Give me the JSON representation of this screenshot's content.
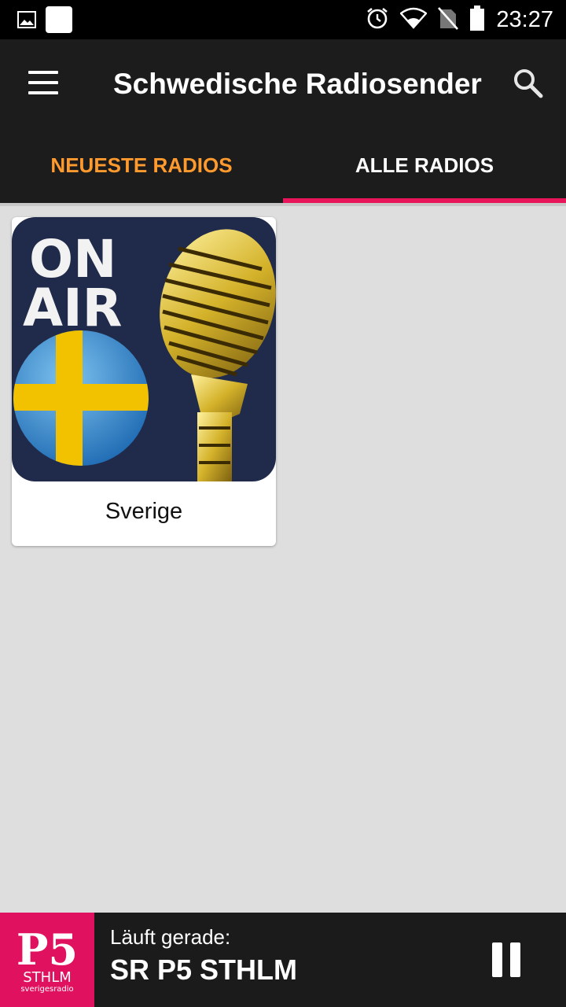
{
  "status_bar": {
    "time": "23:27",
    "icons": [
      "image-notification-icon",
      "app-notification-icon",
      "alarm-icon",
      "wifi-icon",
      "no-sim-icon",
      "battery-icon"
    ]
  },
  "app_bar": {
    "title": "Schwedische Radiosender",
    "menu_icon": "hamburger-menu-icon",
    "search_icon": "search-icon"
  },
  "tabs": [
    {
      "label": "NEUESTE RADIOS",
      "active": true
    },
    {
      "label": "ALLE RADIOS",
      "active": false
    }
  ],
  "colors": {
    "accent_orange": "#ff9a2e",
    "indicator_pink": "#e8155a",
    "player_logo": "#e0115f"
  },
  "stations": [
    {
      "name": "Sverige",
      "image_text": [
        "ON",
        "AIR"
      ]
    }
  ],
  "player": {
    "now_playing_label": "Läuft gerade:",
    "station": "SR P5 STHLM",
    "logo_lines": [
      "P5",
      "STHLM",
      "sverigesradio"
    ],
    "control": "pause-icon"
  }
}
